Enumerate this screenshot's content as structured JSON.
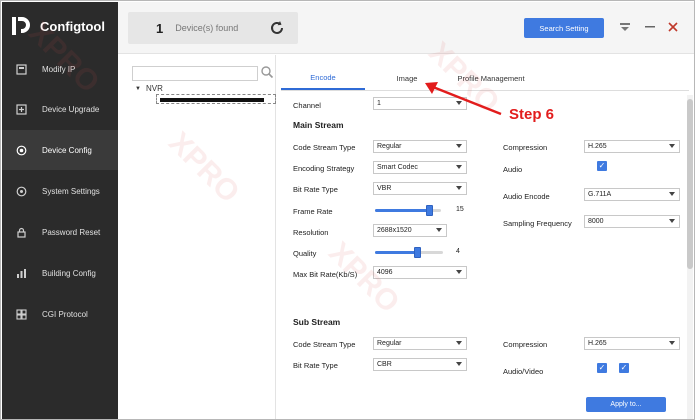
{
  "app": {
    "title": "Configtool"
  },
  "sidebar": {
    "items": [
      {
        "label": "Modify IP",
        "icon": "modify-ip-icon"
      },
      {
        "label": "Device Upgrade",
        "icon": "upgrade-icon"
      },
      {
        "label": "Device Config",
        "icon": "config-icon",
        "active": true
      },
      {
        "label": "System Settings",
        "icon": "settings-icon"
      },
      {
        "label": "Password Reset",
        "icon": "lock-icon"
      },
      {
        "label": "Building Config",
        "icon": "building-icon"
      },
      {
        "label": "CGI Protocol",
        "icon": "protocol-icon"
      }
    ]
  },
  "header": {
    "found_count": "1",
    "found_label": "Device(s) found",
    "search_setting": "Search Setting"
  },
  "tree": {
    "root_label": "NVR"
  },
  "tabs": [
    "Encode",
    "Image",
    "Profile Management"
  ],
  "form": {
    "channel_label": "Channel",
    "channel_value": "1",
    "main_stream_title": "Main Stream",
    "code_stream_type_label": "Code Stream Type",
    "code_stream_type_value": "Regular",
    "encoding_strategy_label": "Encoding Strategy",
    "encoding_strategy_value": "Smart Codec",
    "bit_rate_type_label": "Bit Rate Type",
    "bit_rate_type_value": "VBR",
    "frame_rate_label": "Frame Rate",
    "frame_rate_value": "15",
    "frame_rate_fraction": 0.82,
    "resolution_label": "Resolution",
    "resolution_value": "2688x1520",
    "quality_label": "Quality",
    "quality_value": "4",
    "quality_fraction": 0.62,
    "max_bit_rate_label": "Max Bit Rate(Kb/S)",
    "max_bit_rate_value": "4096",
    "compression_label": "Compression",
    "compression_value": "H.265",
    "audio_label": "Audio",
    "audio_encode_label": "Audio Encode",
    "audio_encode_value": "G.711A",
    "sampling_frequency_label": "Sampling Frequency",
    "sampling_frequency_value": "8000",
    "sub_stream_title": "Sub Stream",
    "sub_code_stream_type_label": "Code Stream Type",
    "sub_code_stream_type_value": "Regular",
    "sub_bit_rate_type_label": "Bit Rate Type",
    "sub_bit_rate_type_value": "CBR",
    "sub_compression_label": "Compression",
    "sub_compression_value": "H.265",
    "sub_audio_video_label": "Audio/Video",
    "apply_label": "Apply to..."
  },
  "annotation": {
    "step": "Step 6",
    "color": "#e21c1c"
  },
  "colors": {
    "accent": "#3f7ae0",
    "sidebar_bg": "#2b2b2b"
  }
}
